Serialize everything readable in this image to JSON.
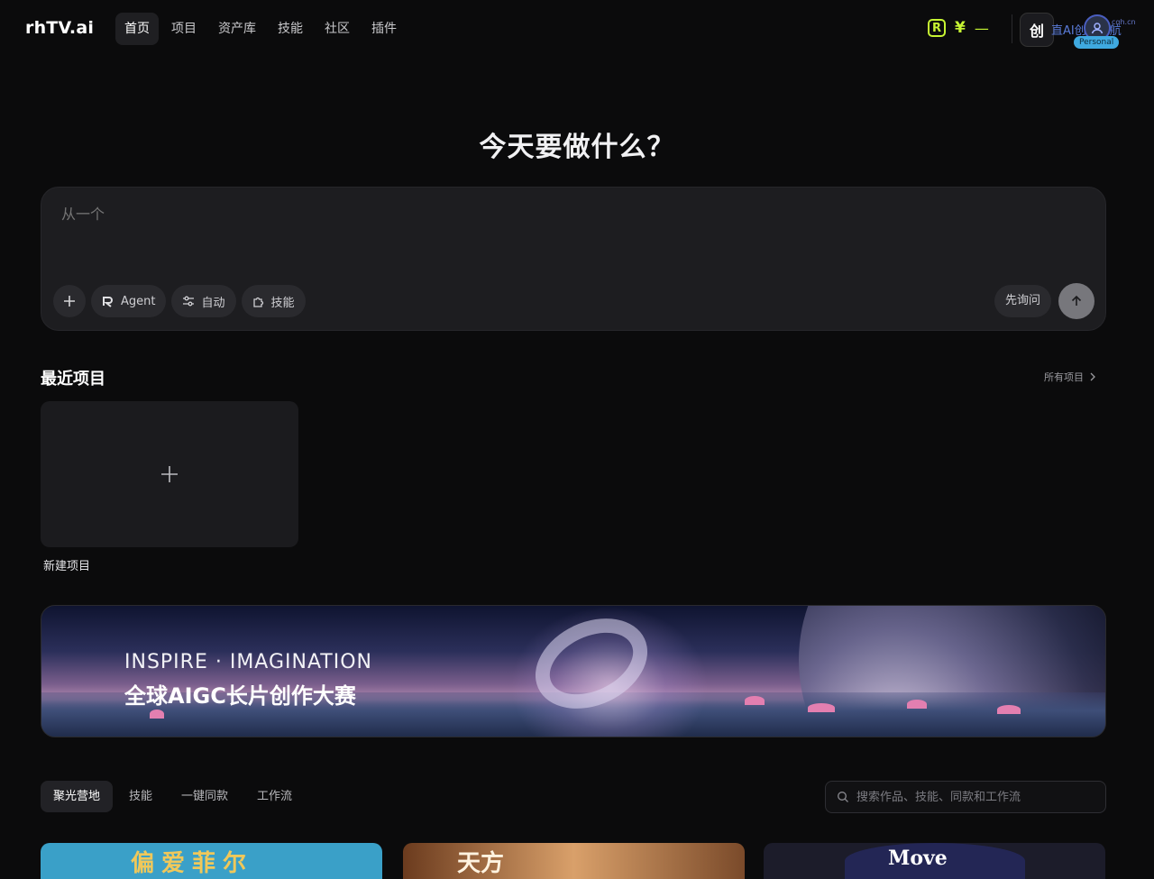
{
  "topbar": {
    "logo": "rhTV.ai",
    "nav": [
      "首页",
      "项目",
      "资产库",
      "技能",
      "社区",
      "插件"
    ],
    "credits_symbol": "¥",
    "credits_value": "—",
    "credits_badge": "R",
    "extension_label": "直AI创作导航",
    "extension_glyph": "创",
    "avatar_sub": "cqh.cn",
    "plan_badge": "Personal",
    "accent_color": "#c6f432"
  },
  "hero": {
    "title": "今天要做什么？"
  },
  "composer": {
    "placeholder": "从一个",
    "agent_label": "Agent",
    "auto_label": "自动",
    "skill_label": "技能",
    "ask_label": "先询问"
  },
  "recent": {
    "title": "最近项目",
    "all_link": "所有项目",
    "new_project_label": "新建项目"
  },
  "banner": {
    "title_en": "INSPIRE · IMAGINATION",
    "title_cn": "全球AIGC长片创作大赛"
  },
  "explore": {
    "tabs": [
      "聚光营地",
      "技能",
      "一键同款",
      "工作流"
    ],
    "search_placeholder": "搜索作品、技能、同款和工作流",
    "cards": [
      {
        "title": "偏爱菲尔"
      },
      {
        "title": "天方"
      },
      {
        "title": "Move"
      }
    ]
  }
}
